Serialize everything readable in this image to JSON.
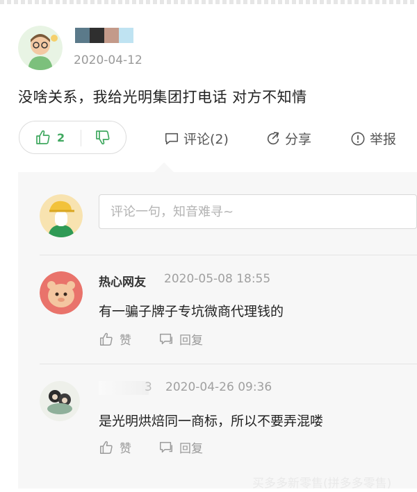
{
  "post": {
    "date": "2020-04-12",
    "text": "没啥关系，我给光明集团打电话 对方不知情",
    "author_blur_colors": [
      "#5b7a8a",
      "#2f2f2f",
      "#c39a8a",
      "#bfe3f2"
    ]
  },
  "votes": {
    "up_count": "2"
  },
  "actions": {
    "comment": "评论(2)",
    "share": "分享",
    "report": "举报"
  },
  "comment_box": {
    "placeholder": "评论一句，知音难寻~"
  },
  "comments": [
    {
      "name": "热心网友",
      "date": "2020-05-08 18:55",
      "text": "有一骗子牌子专坑微商代理钱的",
      "like": "赞",
      "reply": "回复"
    },
    {
      "name": "3",
      "date": "2020-04-26 09:36",
      "text": "是光明烘焙同一商标，所以不要弄混喽",
      "like": "赞",
      "reply": "回复"
    }
  ],
  "watermark": "买多多新零售(拼多多零售)",
  "colors": {
    "accent_green": "#3fa85f",
    "panel_bg": "#f7f7f7"
  }
}
